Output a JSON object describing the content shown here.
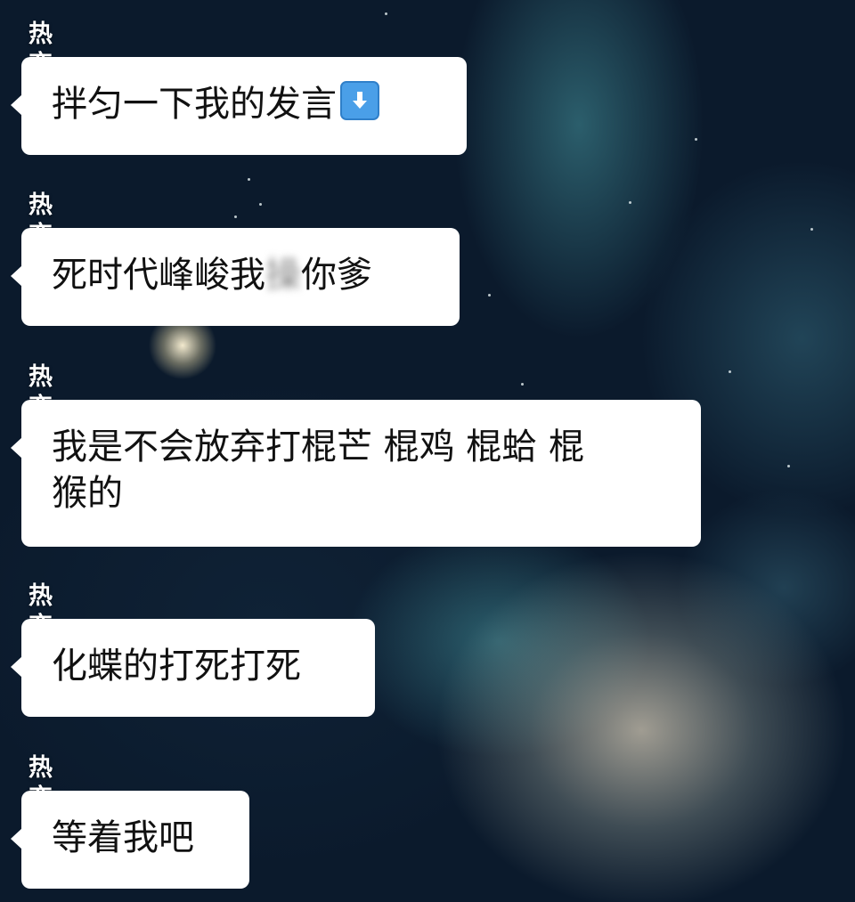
{
  "messages": [
    {
      "sender": "热恋",
      "text": "拌匀一下我的发言",
      "icon": "down-arrow-icon"
    },
    {
      "sender": "热恋",
      "before": "死时代峰峻我",
      "blurred": "操",
      "after": "你爹"
    },
    {
      "sender": "热恋",
      "line1": "我是不会放弃打棍芒 棍鸡 棍蛤 棍",
      "line2": "猴的"
    },
    {
      "sender": "热恋",
      "text": "化蝶的打死打死"
    },
    {
      "sender": "热恋",
      "text": "等着我吧"
    }
  ],
  "colors": {
    "bubble": "#ffffff",
    "sender_text": "#ffffff",
    "message_text": "#111111",
    "icon_blue": "#4a9fe8"
  }
}
